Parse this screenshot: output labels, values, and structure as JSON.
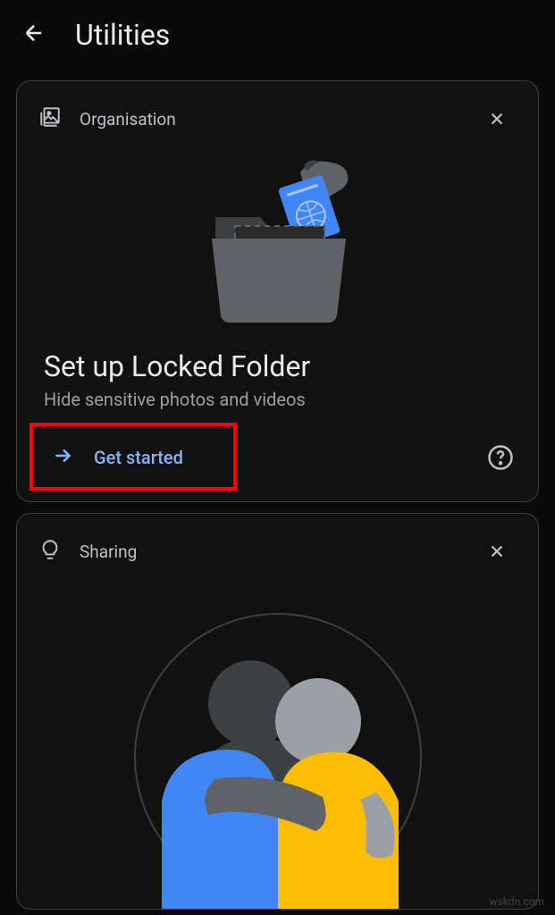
{
  "header": {
    "title": "Utilities"
  },
  "cards": [
    {
      "label": "Organisation",
      "title": "Set up Locked Folder",
      "subtitle": "Hide sensitive photos and videos",
      "action": "Get started"
    },
    {
      "label": "Sharing"
    }
  ],
  "watermark": "wskdn.com"
}
